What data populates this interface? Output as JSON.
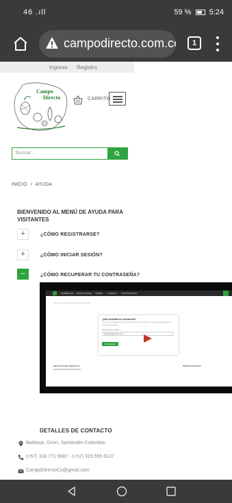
{
  "statusbar": {
    "network": "46 .ıll",
    "icons": [
      "phone-icon",
      "volume-icon"
    ],
    "battery": "59 %",
    "time": "5:24"
  },
  "browser": {
    "url": "campodirecto.com.co/h",
    "tab_count": "1"
  },
  "site": {
    "login_link": "Ingreso",
    "register_link": "Registro",
    "logo_text": "Campo Directo",
    "cart_label": "CARRITO",
    "search_placeholder": "Buscar...",
    "breadcrumb": {
      "home": "INICIO",
      "separator": "/",
      "current": "AYUDA"
    },
    "help_title": "BIENVENIDO AL MENÚ DE AYUDA PARA VISITANTES",
    "accordion": [
      {
        "toggle": "+",
        "label": "¿CÓMO REGISTRARSE?",
        "open": false
      },
      {
        "toggle": "+",
        "label": "¿CÓMO INICIAR SESIÓN?",
        "open": false
      },
      {
        "toggle": "–",
        "label": "¿CÓMO RECUPERAR TU CONTRASEÑA?",
        "open": true
      }
    ],
    "contact": {
      "title": "DETALLES DE CONTACTO",
      "address": "Barbosa, Giron, Santander-Colombia.",
      "phones": "(+57) 318 771 6887 - (+57) 315 555 6137",
      "email": "CampoDirectoCo@gmail.com"
    }
  },
  "embedded_screenshot": {
    "nav_items": [
      "HOMBRE DE",
      "AGRICULTORES",
      "TIENDA",
      "CARRITO",
      "CONTÁCTENOS"
    ],
    "breadcrumb": "Inicio / Mi cuenta / Recuperar contraseña",
    "card_title": "¿Has olvidado tu contraseña?",
    "card_desc": "Por favor introduzca su correo electrónico. Recibirá un enlace para crear una nueva contraseña.",
    "field_label": "Nombre de usuario *",
    "field_value": "Nombre@correo.com",
    "button": "Restablecer",
    "footer_left": "DETALLES DE CONTACTO",
    "footer_right": "REDES SOCIALES"
  },
  "colors": {
    "brand_green": "#2fa33f",
    "system_bar": "#3a3a3a",
    "url_field": "#525252",
    "arrow_red": "#c0392b"
  }
}
